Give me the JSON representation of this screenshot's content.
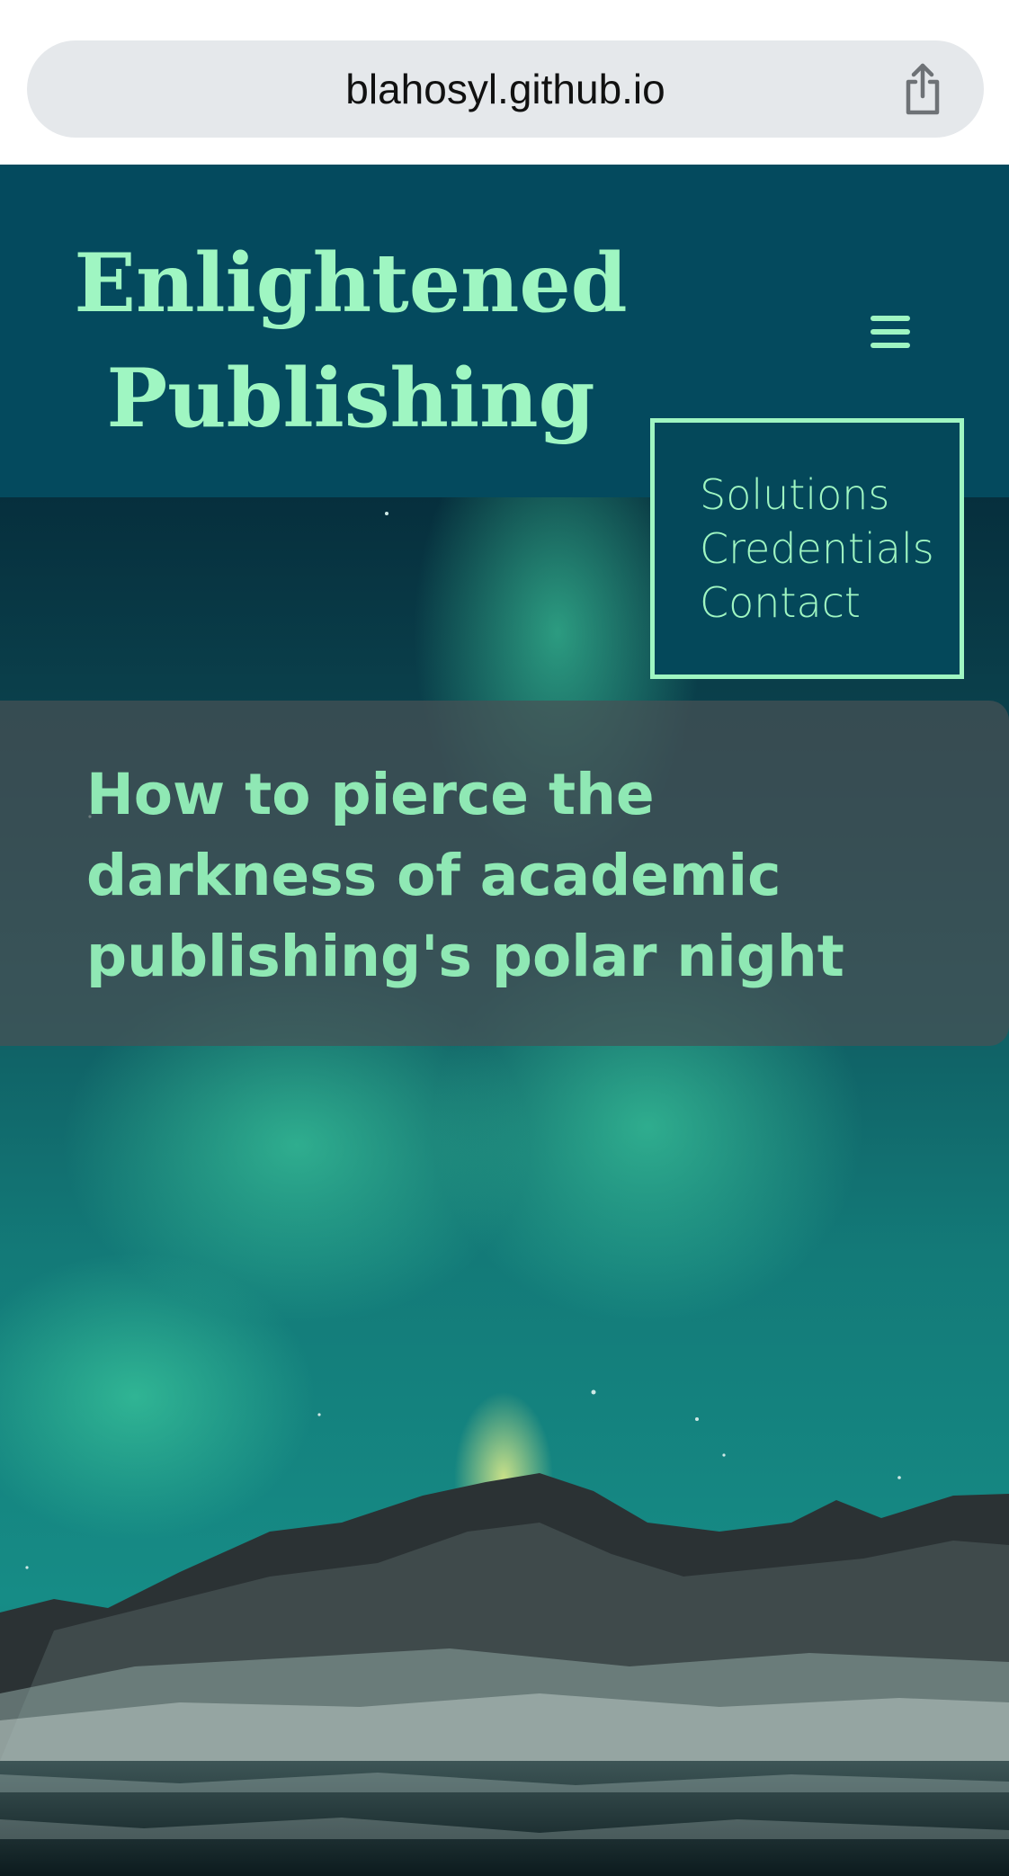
{
  "browser": {
    "url": "blahosyl.github.io",
    "share_icon": "share-icon"
  },
  "site": {
    "brand_line1": "Enlightened",
    "brand_line2": "Publishing",
    "menu_icon": "hamburger-menu-icon",
    "nav": [
      {
        "label": "Solutions"
      },
      {
        "label": "Credentials"
      },
      {
        "label": "Contact"
      }
    ]
  },
  "hero": {
    "headline": "How to pierce the darkness of academic publishing's polar night",
    "image": "aurora-over-mountains-image"
  },
  "colors": {
    "header_bg": "#044a5e",
    "accent": "#9ff6c2",
    "headline_text": "#8fe8b4",
    "panel_bg": "#485054",
    "urlbar_bg": "#e5e8eb"
  }
}
